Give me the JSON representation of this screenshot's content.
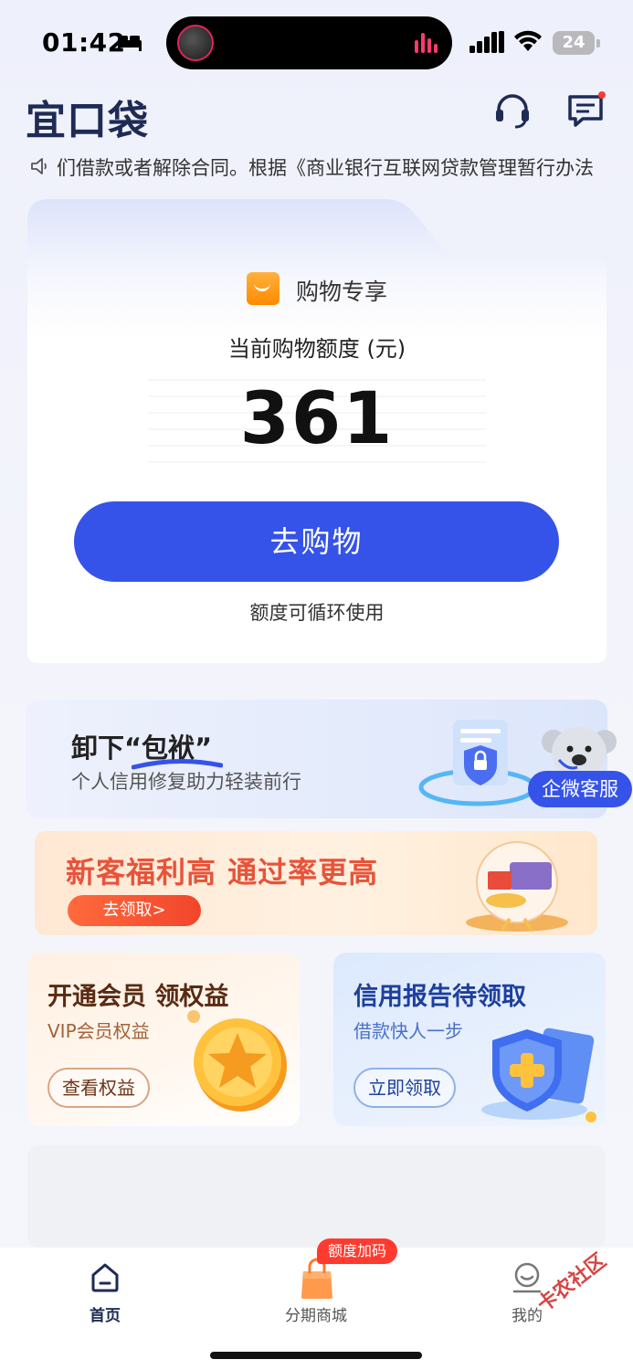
{
  "status_bar": {
    "time": "01:42",
    "battery": "24"
  },
  "header": {
    "logo": "宜口袋"
  },
  "notice": {
    "text": "们借款或者解除合同。根据《商业银行互联网贷款管理暂行办法"
  },
  "main_card": {
    "tag_label": "购物专享",
    "quota_label": "当前购物额度 (元)",
    "quota_value": "361",
    "button_label": "去购物",
    "note": "额度可循环使用"
  },
  "banner_service": {
    "title": "卸下“包袱”",
    "subtitle": "个人信用修复助力轻装前行",
    "badge": "企微客服"
  },
  "banner_newcomer": {
    "title": "新客福利高 通过率更高",
    "button": "去领取>"
  },
  "vip_card": {
    "title": "开通会员 领权益",
    "subtitle": "VIP会员权益",
    "button": "查看权益"
  },
  "credit_card": {
    "title": "信用报告待领取",
    "subtitle": "借款快人一步",
    "button": "立即领取"
  },
  "tab_bar": {
    "home": "首页",
    "mall": "分期商城",
    "mall_badge": "额度加码",
    "mine": "我的"
  },
  "watermark": "卡农社区",
  "colors": {
    "primary": "#3553e8",
    "logo": "#1d2b55",
    "promo_red": "#e8533a",
    "badge_red": "#ff3b30"
  },
  "icons": [
    "bed-icon",
    "signal-icon",
    "wifi-icon",
    "headset-icon",
    "message-icon",
    "speaker-icon",
    "bag-icon",
    "home-icon",
    "mall-bag-icon",
    "profile-icon"
  ]
}
